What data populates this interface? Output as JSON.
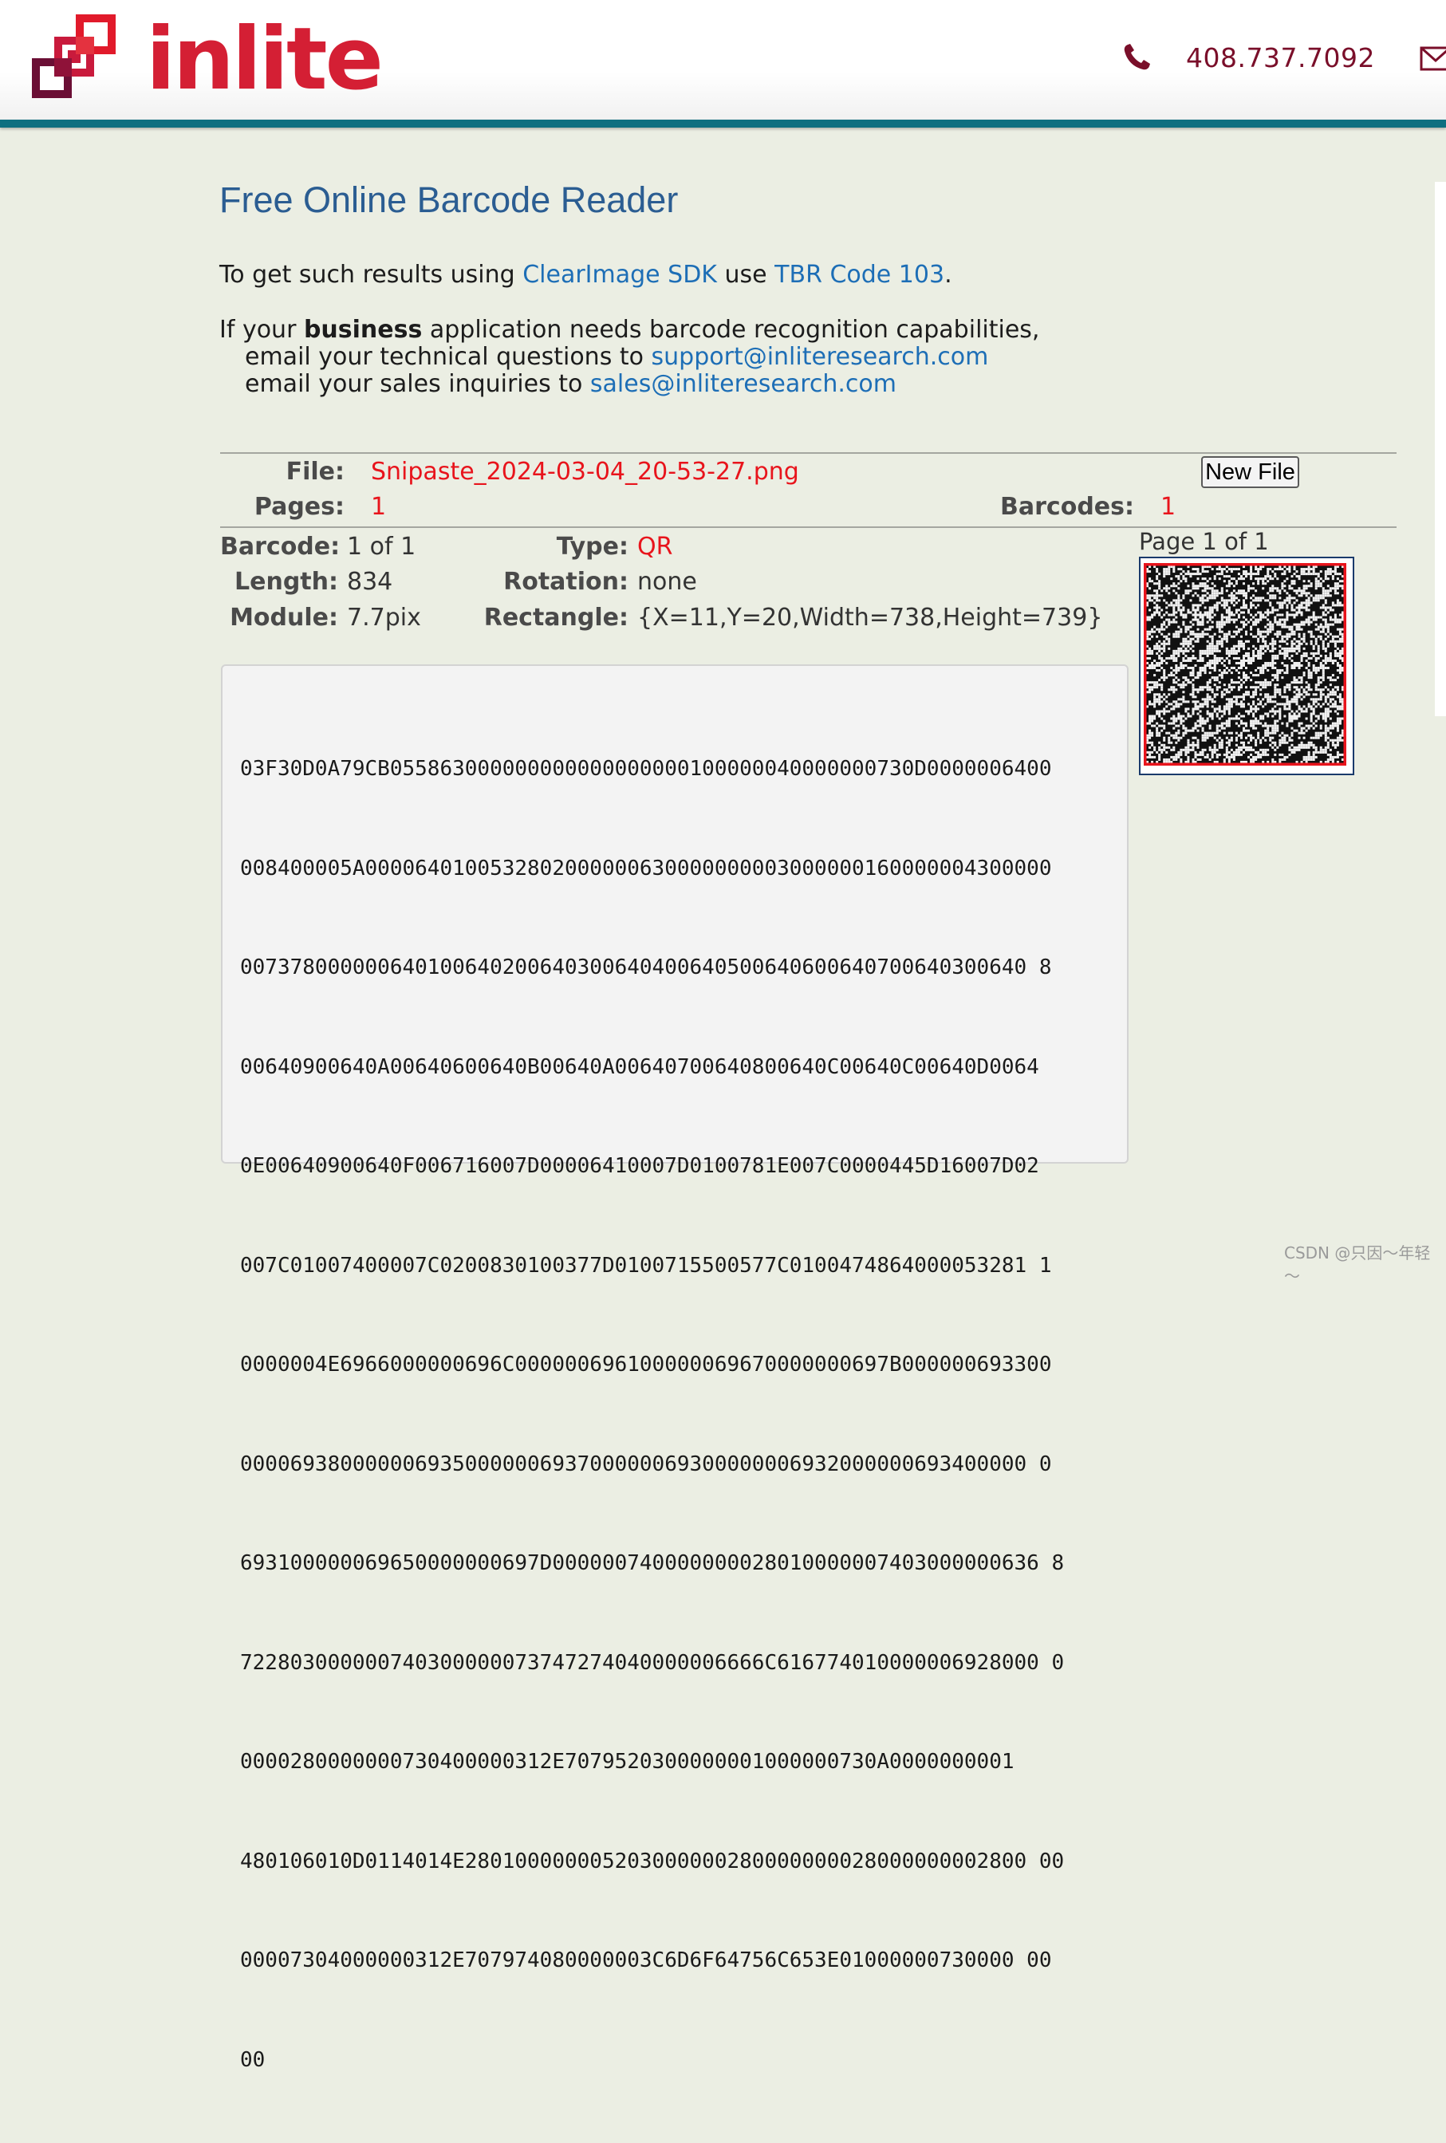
{
  "header": {
    "logo_text": "inlite",
    "phone": "408.737.7092"
  },
  "page": {
    "title": "Free Online Barcode Reader",
    "intro_prefix": "To get such results using ",
    "sdk_link": "ClearImage SDK",
    "intro_mid": " use ",
    "code_link": "TBR Code 103",
    "intro_suffix": ".",
    "business_prefix": "If your ",
    "business_bold": "business",
    "business_suffix": " application needs barcode recognition capabilities,",
    "tech_prefix": "email your technical questions to ",
    "tech_email": "support@inliteresearch.com",
    "sales_prefix": "email your sales inquiries to ",
    "sales_email": "sales@inliteresearch.com"
  },
  "file_info": {
    "file_label": "File:",
    "file_name": "Snipaste_2024-03-04_20-53-27.png",
    "new_file_button": "New File",
    "pages_label": "Pages:",
    "pages_value": "1",
    "barcodes_label": "Barcodes:",
    "barcodes_value": "1"
  },
  "barcode": {
    "barcode_label": "Barcode:",
    "barcode_value": "1 of 1",
    "length_label": "Length:",
    "length_value": "834",
    "module_label": "Module:",
    "module_value": "7.7pix",
    "type_label": "Type:",
    "type_value": "QR",
    "rotation_label": "Rotation:",
    "rotation_value": "none",
    "rectangle_label": "Rectangle:",
    "rectangle_value": "{X=11,Y=20,Width=738,Height=739}"
  },
  "data_lines": [
    "03F30D0A79CB055863000000000000000000100000040000000730D0000006400",
    "008400005A0000640100532802000000630000000003000000160000004300000",
    "007378000000640100640200640300640400640500640600640700640300640 8",
    "00640900640A00640600640B00640A00640700640800640C00640C00640D0064",
    "0E00640900640F006716007D00006410007D0100781E007C0000445D16007D02",
    "007C01007400007C0200830100377D0100715500577C0100474864000053281 1",
    "0000004E6966000000696C000000696100000069670000000697B000000693300",
    "000069380000006935000000693700000069300000006932000000693400000 0",
    "693100000069650000000697D000000740000000028010000007403000000636 8",
    "722803000000740300000073747274040000006666C616774010000006928000 0",
    "0000280000000730400000312E7079520300000001000000730A0000000001",
    "480106010D0114014E280100000005203000000280000000028000000002800 00",
    "00007304000000312E707974080000003C6D6F64756C653E01000000730000 00",
    "00"
  ],
  "thumbnail": {
    "caption": "Page 1 of 1"
  },
  "watermark": "CSDN @只因～年轻～"
}
